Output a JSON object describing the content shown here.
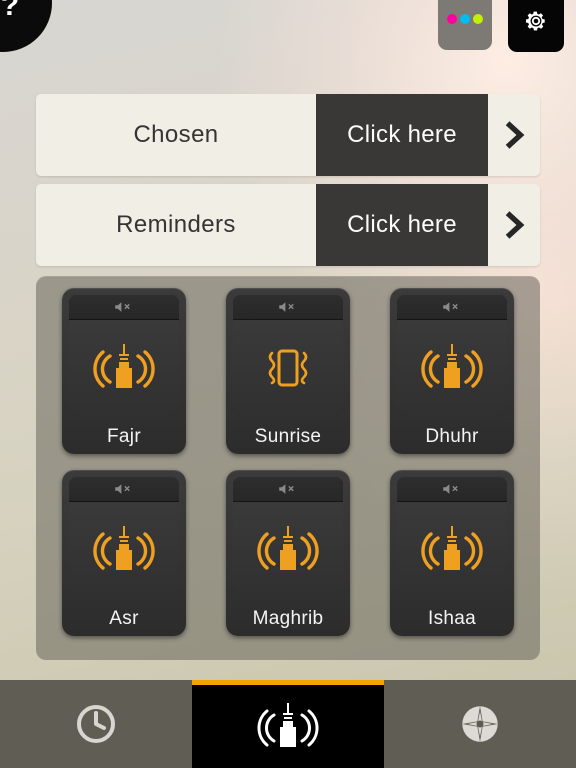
{
  "header": {
    "help_button": {
      "label": "?",
      "icon": "question-mark-icon"
    },
    "color_dots": {
      "icon": "color-dots-icon",
      "colors": [
        "#ff00a0",
        "#00bdf2",
        "#c3f000"
      ]
    },
    "settings_button": {
      "icon": "gear-icon"
    }
  },
  "options": [
    {
      "label": "Chosen",
      "action_label": "Click here",
      "chevron": "chevron-right-icon"
    },
    {
      "label": "Reminders",
      "action_label": "Click here",
      "chevron": "chevron-right-icon"
    }
  ],
  "prayers": [
    {
      "label": "Fajr",
      "mute_icon": "speaker-mute-icon",
      "main_icon": "adhan-minaret-icon",
      "vibrate_icon": "vibrate-icon",
      "vibrate_on": false
    },
    {
      "label": "Sunrise",
      "mute_icon": "speaker-mute-icon",
      "main_icon": "vibrate-icon",
      "vibrate_icon": null,
      "vibrate_on": true
    },
    {
      "label": "Dhuhr",
      "mute_icon": "speaker-mute-icon",
      "main_icon": "adhan-minaret-icon",
      "vibrate_icon": "vibrate-icon",
      "vibrate_on": false
    },
    {
      "label": "Asr",
      "mute_icon": "speaker-mute-icon",
      "main_icon": "adhan-minaret-icon",
      "vibrate_icon": "vibrate-icon",
      "vibrate_on": false
    },
    {
      "label": "Maghrib",
      "mute_icon": "speaker-mute-icon",
      "main_icon": "adhan-minaret-icon",
      "vibrate_icon": "vibrate-icon",
      "vibrate_on": true
    },
    {
      "label": "Ishaa",
      "mute_icon": "speaker-mute-icon",
      "main_icon": "adhan-minaret-icon",
      "vibrate_icon": "vibrate-icon",
      "vibrate_on": false
    }
  ],
  "tabs": [
    {
      "name": "times",
      "icon": "clock-icon",
      "active": false
    },
    {
      "name": "adhan",
      "icon": "adhan-minaret-icon",
      "active": true
    },
    {
      "name": "qibla",
      "icon": "compass-icon",
      "active": false
    }
  ],
  "colors": {
    "accent_orange": "#f5a300",
    "icon_orange": "#f0a021",
    "row_bg": "#f1eee6",
    "action_bg": "#3a3836",
    "tile_bg": "#343434",
    "tabbar_bg": "#605d55",
    "active_tab_bg": "#000000"
  }
}
